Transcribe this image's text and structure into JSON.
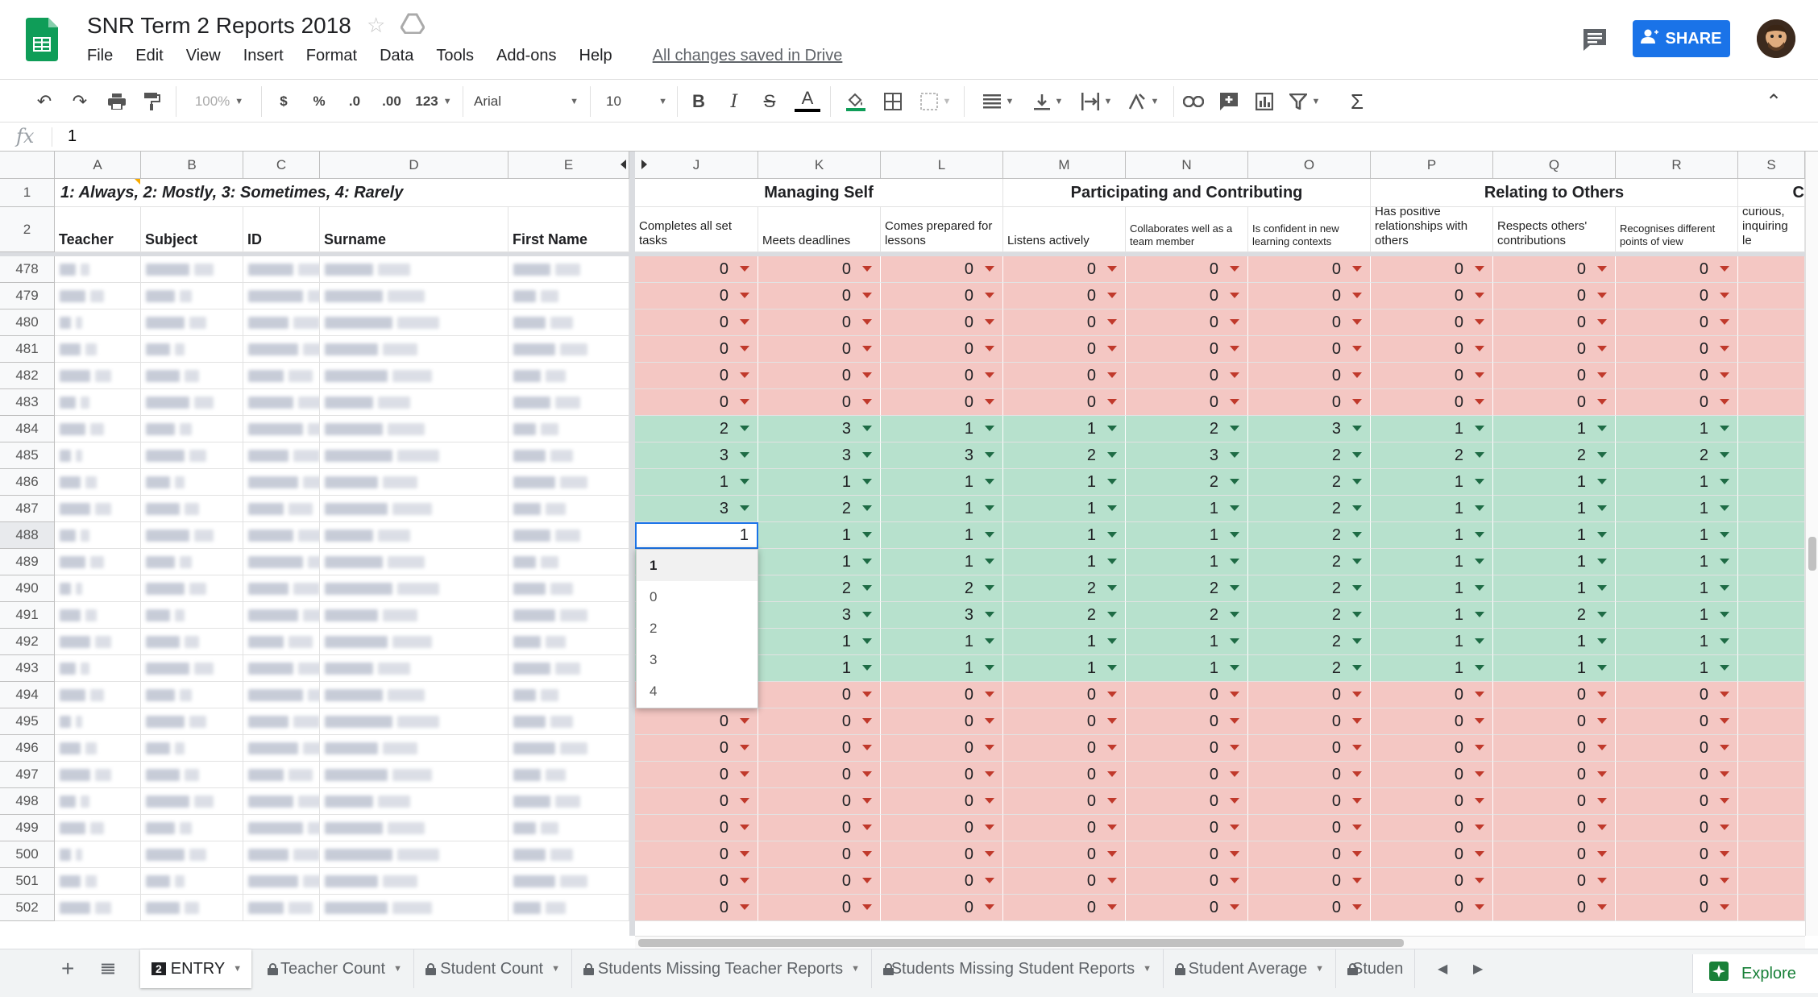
{
  "app": {
    "doc_title": "SNR Term 2 Reports 2018",
    "saved_status": "All changes saved in Drive",
    "share_label": "SHARE",
    "menu": [
      "File",
      "Edit",
      "View",
      "Insert",
      "Format",
      "Data",
      "Tools",
      "Add-ons",
      "Help"
    ]
  },
  "toolbar": {
    "zoom": "100%",
    "currency": "$",
    "percent": "%",
    "decrease_decimals": ".0",
    "increase_decimals": ".00",
    "more_formats": "123",
    "font": "Arial",
    "font_size": "10",
    "bold": "B",
    "italic": "I",
    "strike": "S",
    "text_color": "A",
    "sum": "Σ"
  },
  "formula_bar": {
    "label": "fx",
    "value": "1"
  },
  "columns": {
    "pinned": [
      "A",
      "B",
      "C",
      "D",
      "E"
    ],
    "scroll": [
      "J",
      "K",
      "L",
      "M",
      "N",
      "O",
      "P",
      "Q",
      "R",
      "S"
    ]
  },
  "header_rows": {
    "row1_num": "1",
    "row2_num": "2",
    "legend": "1: Always, 2: Mostly, 3: Sometimes, 4: Rarely",
    "pinned_headers": [
      "Teacher",
      "Subject",
      "ID",
      "Surname",
      "First Name"
    ],
    "groups": [
      "Managing Self",
      "Participating and Contributing",
      "Relating to Others",
      "C"
    ],
    "criteria": [
      "Completes all set tasks",
      "Meets deadlines",
      "Comes prepared for lessons",
      "Listens actively",
      "Collaborates well as a team member",
      "Is confident in new learning contexts",
      "Has positive relationships with others",
      "Respects others' contributions",
      "Recognises different points of view",
      "Is a curious, inquiring le"
    ]
  },
  "rows": [
    {
      "num": "478",
      "values": [
        "0",
        "0",
        "0",
        "0",
        "0",
        "0",
        "0",
        "0",
        "0"
      ],
      "status": "missing"
    },
    {
      "num": "479",
      "values": [
        "0",
        "0",
        "0",
        "0",
        "0",
        "0",
        "0",
        "0",
        "0"
      ],
      "status": "missing"
    },
    {
      "num": "480",
      "values": [
        "0",
        "0",
        "0",
        "0",
        "0",
        "0",
        "0",
        "0",
        "0"
      ],
      "status": "missing"
    },
    {
      "num": "481",
      "values": [
        "0",
        "0",
        "0",
        "0",
        "0",
        "0",
        "0",
        "0",
        "0"
      ],
      "status": "missing"
    },
    {
      "num": "482",
      "values": [
        "0",
        "0",
        "0",
        "0",
        "0",
        "0",
        "0",
        "0",
        "0"
      ],
      "status": "missing"
    },
    {
      "num": "483",
      "values": [
        "0",
        "0",
        "0",
        "0",
        "0",
        "0",
        "0",
        "0",
        "0"
      ],
      "status": "missing"
    },
    {
      "num": "484",
      "values": [
        "2",
        "3",
        "1",
        "1",
        "2",
        "3",
        "1",
        "1",
        "1"
      ],
      "status": "complete"
    },
    {
      "num": "485",
      "values": [
        "3",
        "3",
        "3",
        "2",
        "3",
        "2",
        "2",
        "2",
        "2"
      ],
      "status": "complete"
    },
    {
      "num": "486",
      "values": [
        "1",
        "1",
        "1",
        "1",
        "2",
        "2",
        "1",
        "1",
        "1"
      ],
      "status": "complete"
    },
    {
      "num": "487",
      "values": [
        "3",
        "2",
        "1",
        "1",
        "1",
        "2",
        "1",
        "1",
        "1"
      ],
      "status": "complete"
    },
    {
      "num": "488",
      "values": [
        "1",
        "1",
        "1",
        "1",
        "1",
        "2",
        "1",
        "1",
        "1"
      ],
      "status": "complete"
    },
    {
      "num": "489",
      "values": [
        "",
        "1",
        "1",
        "1",
        "1",
        "2",
        "1",
        "1",
        "1"
      ],
      "status": "complete"
    },
    {
      "num": "490",
      "values": [
        "",
        "2",
        "2",
        "2",
        "2",
        "2",
        "1",
        "1",
        "1"
      ],
      "status": "complete"
    },
    {
      "num": "491",
      "values": [
        "",
        "3",
        "3",
        "2",
        "2",
        "2",
        "1",
        "2",
        "1"
      ],
      "status": "complete"
    },
    {
      "num": "492",
      "values": [
        "",
        "1",
        "1",
        "1",
        "1",
        "2",
        "1",
        "1",
        "1"
      ],
      "status": "complete"
    },
    {
      "num": "493",
      "values": [
        "",
        "1",
        "1",
        "1",
        "1",
        "2",
        "1",
        "1",
        "1"
      ],
      "status": "complete"
    },
    {
      "num": "494",
      "values": [
        "",
        "0",
        "0",
        "0",
        "0",
        "0",
        "0",
        "0",
        "0"
      ],
      "status": "missing"
    },
    {
      "num": "495",
      "values": [
        "0",
        "0",
        "0",
        "0",
        "0",
        "0",
        "0",
        "0",
        "0"
      ],
      "status": "missing"
    },
    {
      "num": "496",
      "values": [
        "0",
        "0",
        "0",
        "0",
        "0",
        "0",
        "0",
        "0",
        "0"
      ],
      "status": "missing"
    },
    {
      "num": "497",
      "values": [
        "0",
        "0",
        "0",
        "0",
        "0",
        "0",
        "0",
        "0",
        "0"
      ],
      "status": "missing"
    },
    {
      "num": "498",
      "values": [
        "0",
        "0",
        "0",
        "0",
        "0",
        "0",
        "0",
        "0",
        "0"
      ],
      "status": "missing"
    },
    {
      "num": "499",
      "values": [
        "0",
        "0",
        "0",
        "0",
        "0",
        "0",
        "0",
        "0",
        "0"
      ],
      "status": "missing"
    },
    {
      "num": "500",
      "values": [
        "0",
        "0",
        "0",
        "0",
        "0",
        "0",
        "0",
        "0",
        "0"
      ],
      "status": "missing"
    },
    {
      "num": "501",
      "values": [
        "0",
        "0",
        "0",
        "0",
        "0",
        "0",
        "0",
        "0",
        "0"
      ],
      "status": "missing"
    },
    {
      "num": "502",
      "values": [
        "0",
        "0",
        "0",
        "0",
        "0",
        "0",
        "0",
        "0",
        "0"
      ],
      "status": "missing"
    }
  ],
  "active_cell": {
    "row": "488",
    "value": "1"
  },
  "dropdown_options": [
    "1",
    "0",
    "2",
    "3",
    "4"
  ],
  "sheet_tabs": [
    {
      "label": "ENTRY",
      "badge": "2",
      "active": true,
      "locked": false
    },
    {
      "label": "Teacher Count",
      "locked": true
    },
    {
      "label": "Student Count",
      "locked": true
    },
    {
      "label": "Students Missing Teacher Reports",
      "locked": true
    },
    {
      "label": "Students Missing Student Reports",
      "locked": true
    },
    {
      "label": "Student Average",
      "locked": true
    },
    {
      "label": "Studen",
      "locked": true
    }
  ],
  "explore_label": "Explore",
  "colors": {
    "missing_fill": "#f4c7c3",
    "complete_fill": "#b7e1cd",
    "accent": "#1a73e8",
    "sheets_green": "#0f9d58"
  }
}
